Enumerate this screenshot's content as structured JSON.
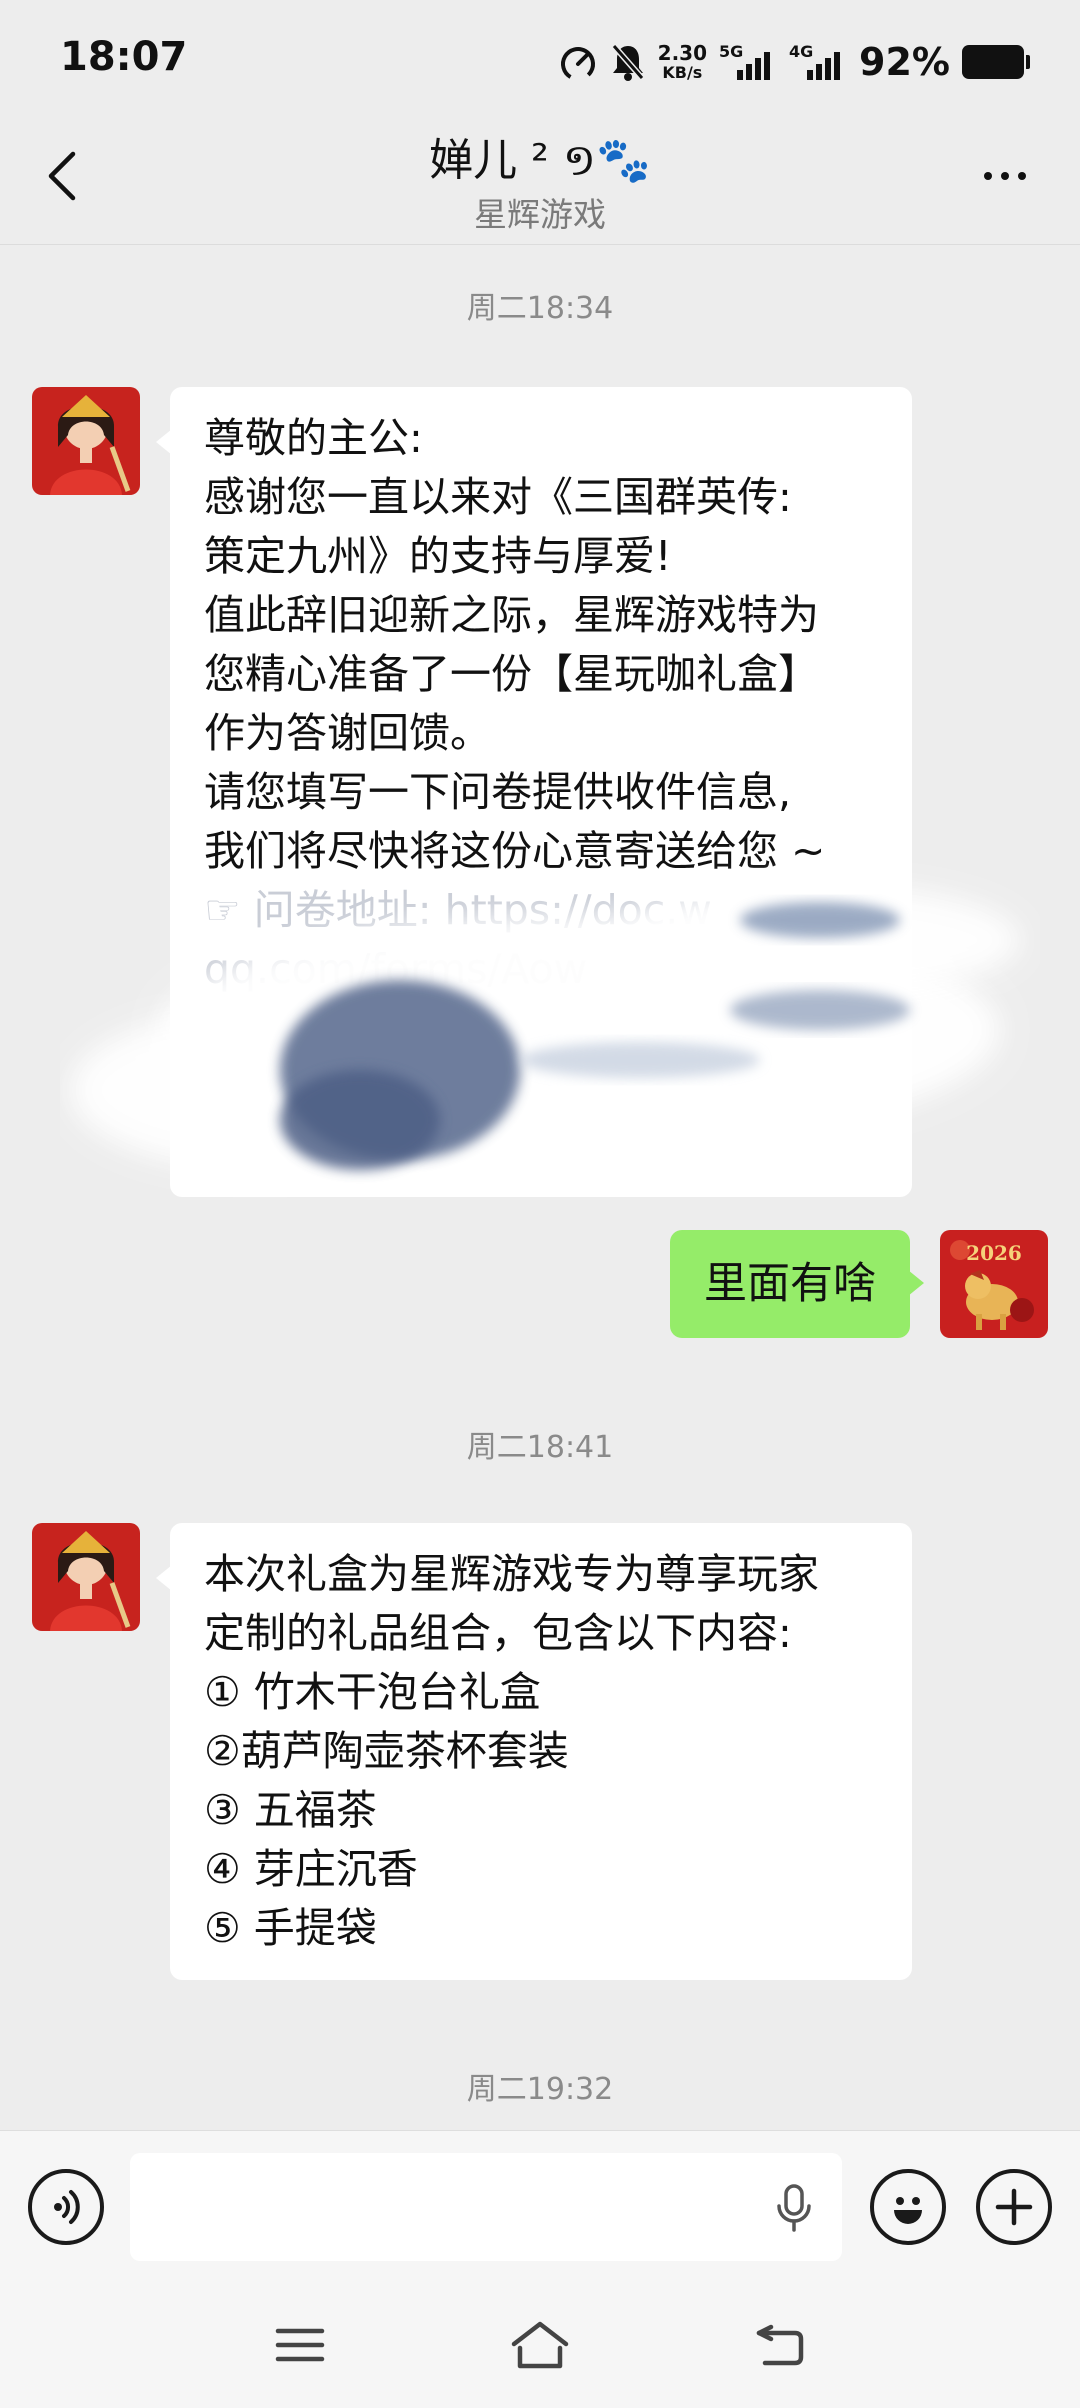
{
  "status_bar": {
    "time": "18:07",
    "net_speed_value": "2.30",
    "net_speed_unit": "KB/s",
    "network_1": "5G",
    "network_2": "4G",
    "battery_percent": "92%",
    "icons": [
      "speedometer-icon",
      "bell-muted-icon",
      "signal-icon",
      "battery-icon"
    ]
  },
  "header": {
    "title": "婵儿 ² ១🐾",
    "subtitle": "星辉游戏",
    "icons": [
      "back-arrow-icon",
      "more-dots-icon"
    ]
  },
  "messages": [
    {
      "timestamp": "周二18:34",
      "from": "other",
      "lines": [
        "尊敬的主公:",
        "感谢您一直以来对《三国群英传:",
        "策定九州》的支持与厚爱!",
        "值此辞旧迎新之际，星辉游戏特为",
        "您精心准备了一份【星玩咖礼盒】",
        "作为答谢回馈。",
        "请您填写一下问卷提供收件信息,",
        "我们将尽快将这份心意寄送给您 ~",
        "",
        "☞ 问卷地址: https://doc.w",
        "qq.com/forms/Aow"
      ]
    },
    {
      "from": "me",
      "text": "里面有啥"
    },
    {
      "timestamp": "周二18:41",
      "from": "other",
      "lines": [
        "本次礼盒为星辉游戏专为尊享玩家",
        "定制的礼品组合，包含以下内容:",
        "① 竹木干泡台礼盒",
        "②葫芦陶壶茶杯套装",
        "③ 五福茶",
        "④ 芽庄沉香",
        "⑤ 手提袋"
      ]
    },
    {
      "timestamp": "周二19:32"
    }
  ],
  "input_bar": {
    "placeholder": "",
    "icons": [
      "voice-mode-icon",
      "microphone-icon",
      "emoji-icon",
      "plus-icon"
    ]
  },
  "nav_bar": {
    "icons": [
      "menu-icon",
      "home-icon",
      "back-icon"
    ]
  },
  "colors": {
    "background": "#ededed",
    "bubble_in": "#ffffff",
    "bubble_out": "#95ec69",
    "timestamp": "#8a8a8a"
  }
}
